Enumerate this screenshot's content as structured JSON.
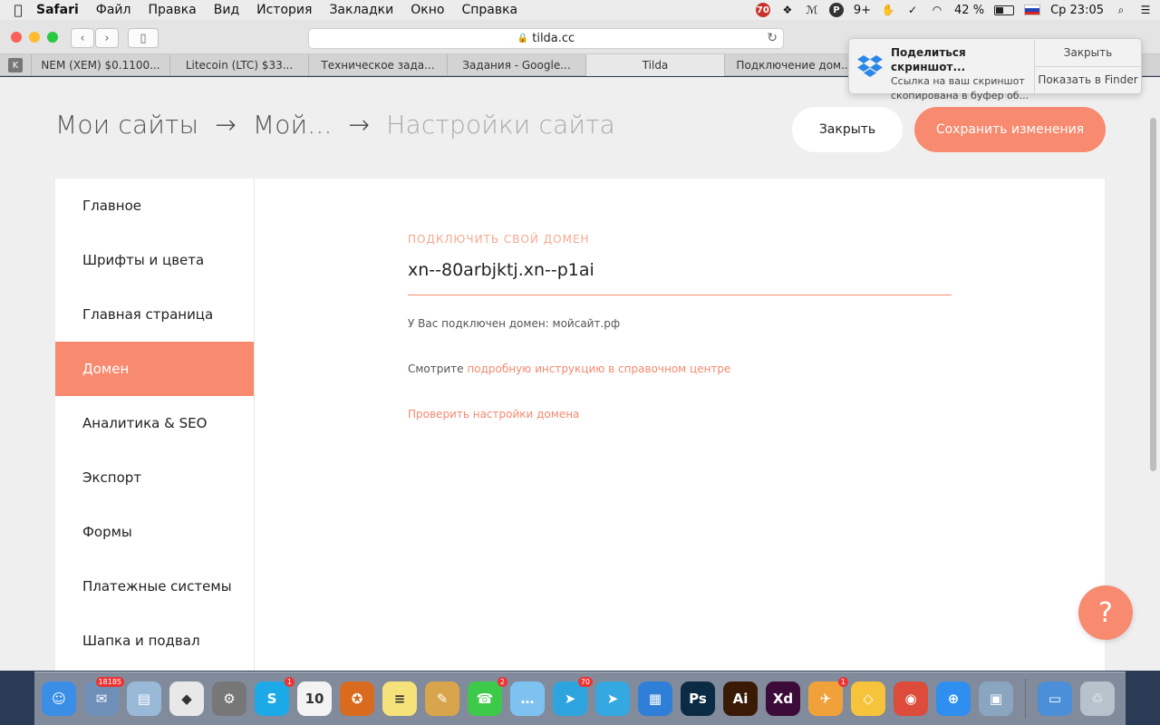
{
  "menubar": {
    "app": "Safari",
    "items": [
      "Файл",
      "Правка",
      "Вид",
      "История",
      "Закладки",
      "Окно",
      "Справка"
    ],
    "status": {
      "badge": "70",
      "p_count": "9+",
      "battery": "42 %",
      "clock": "Ср 23:05"
    }
  },
  "browser": {
    "url": "tilda.cc",
    "tabs": [
      {
        "label": "NEM (XEM) $0.1100..."
      },
      {
        "label": "Litecoin (LTC) $33..."
      },
      {
        "label": "Техническое зада..."
      },
      {
        "label": "Задания - Google..."
      },
      {
        "label": "Tilda"
      },
      {
        "label": "Подключение дом..."
      }
    ],
    "active_tab": 4
  },
  "notification": {
    "title": "Поделиться скриншот...",
    "body_line1": "Ссылка на ваш скриншот",
    "body_line2": "скопирована в буфер об...",
    "action_close": "Закрыть",
    "action_finder": "Показать в Finder"
  },
  "page": {
    "breadcrumb": {
      "root": "Мои сайты",
      "sep": "→",
      "site": "Мой...",
      "current": "Настройки сайта"
    },
    "close_label": "Закрыть",
    "save_label": "Сохранить изменения",
    "sidebar": {
      "items": [
        {
          "label": "Главное"
        },
        {
          "label": "Шрифты и цвета"
        },
        {
          "label": "Главная страница"
        },
        {
          "label": "Домен"
        },
        {
          "label": "Аналитика & SEO"
        },
        {
          "label": "Экспорт"
        },
        {
          "label": "Формы"
        },
        {
          "label": "Платежные системы"
        },
        {
          "label": "Шапка и подвал"
        }
      ],
      "active_index": 3
    },
    "domain": {
      "label": "Подключить свой домен",
      "value": "xn--80arbjktj.xn--p1ai",
      "connected_text": "У Вас подключен домен: мойсайт.рф",
      "guide_prefix": "Смотрите ",
      "guide_link": "подробную инструкцию в справочном центре",
      "check_link": "Проверить настройки домена"
    },
    "help_label": "?"
  },
  "dock": {
    "apps": [
      {
        "name": "finder",
        "glyph": "☺",
        "color": "#3a8ee6"
      },
      {
        "name": "mail",
        "glyph": "✉",
        "color": "#6d8fb8",
        "badge": "18185"
      },
      {
        "name": "preview",
        "glyph": "▤",
        "color": "#9ab9d9"
      },
      {
        "name": "yandex-disk",
        "glyph": "◆",
        "color": "#e8e8e8"
      },
      {
        "name": "system-preferences",
        "glyph": "⚙",
        "color": "#777"
      },
      {
        "name": "skype",
        "glyph": "S",
        "color": "#1ca9e8",
        "badge": "1"
      },
      {
        "name": "calendar",
        "glyph": "10",
        "color": "#f3f3f3"
      },
      {
        "name": "brave",
        "glyph": "✪",
        "color": "#d96b1e"
      },
      {
        "name": "notes",
        "glyph": "≡",
        "color": "#f6e27a"
      },
      {
        "name": "textedit",
        "glyph": "✎",
        "color": "#d9a54c"
      },
      {
        "name": "facetime",
        "glyph": "☎",
        "color": "#3dc94a",
        "badge": "2"
      },
      {
        "name": "messages",
        "glyph": "…",
        "color": "#7ec3f0"
      },
      {
        "name": "telegram",
        "glyph": "➤",
        "color": "#2ea4df",
        "badge": "70"
      },
      {
        "name": "telegram-desktop",
        "glyph": "➤",
        "color": "#34a8e0"
      },
      {
        "name": "keynote",
        "glyph": "▦",
        "color": "#2f7fd9"
      },
      {
        "name": "photoshop",
        "glyph": "Ps",
        "color": "#0b2a44"
      },
      {
        "name": "illustrator",
        "glyph": "Ai",
        "color": "#3a1a05"
      },
      {
        "name": "xd",
        "glyph": "Xd",
        "color": "#3d0b3a"
      },
      {
        "name": "airmail",
        "glyph": "✈",
        "color": "#f1a13a",
        "badge": "1"
      },
      {
        "name": "sketch",
        "glyph": "◇",
        "color": "#f7c33a"
      },
      {
        "name": "chrome",
        "glyph": "◉",
        "color": "#dd4b3b"
      },
      {
        "name": "safari",
        "glyph": "⊕",
        "color": "#2f8ff0"
      },
      {
        "name": "image-capture",
        "glyph": "▣",
        "color": "#8aa5c0"
      },
      {
        "name": "downloads",
        "glyph": "▭",
        "color": "#4a8fd8"
      },
      {
        "name": "trash",
        "glyph": "♲",
        "color": "#b8c2cc"
      }
    ]
  }
}
